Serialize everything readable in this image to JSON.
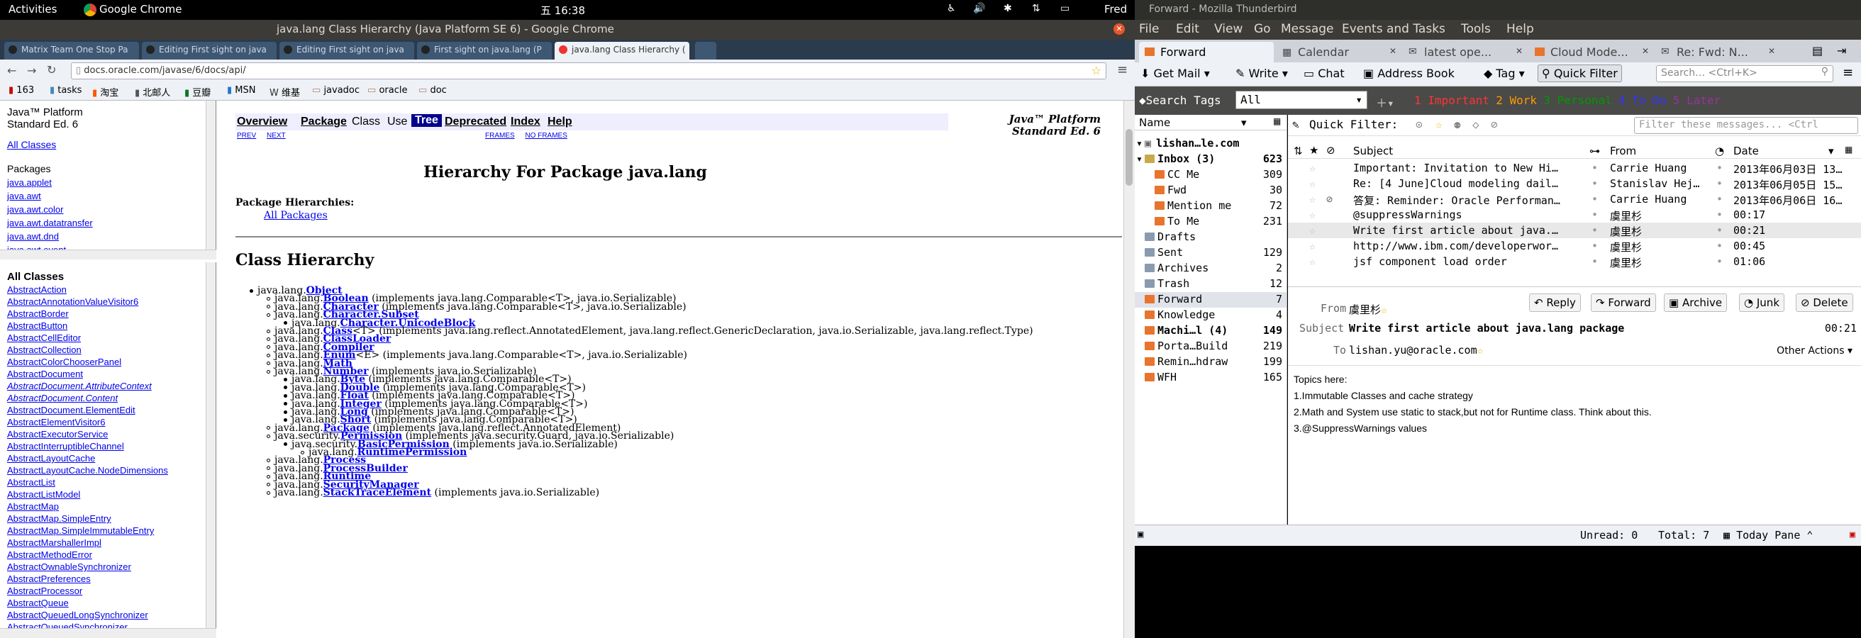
{
  "topbar": {
    "activities": "Activities",
    "app": "Google Chrome",
    "time": "五 16:38",
    "user": "Fred"
  },
  "chrome": {
    "title": "java.lang Class Hierarchy (Java Platform SE 6) - Google Chrome",
    "tabs": [
      "Matrix Team One Stop Pa",
      "Editing First sight on java",
      "Editing First sight on java",
      "First sight on java.lang (P",
      "java.lang Class Hierarchy ("
    ],
    "url": "docs.oracle.com/javase/6/docs/api/",
    "bookmarks": [
      "163",
      "tasks",
      "淘宝",
      "北邮人",
      "豆瓣",
      "MSN",
      "维基",
      "javadoc",
      "oracle",
      "doc"
    ]
  },
  "pkg_frame": {
    "title1": "Java™ Platform",
    "title2": "Standard Ed. 6",
    "all_classes": "All Classes",
    "packages_label": "Packages",
    "packages": [
      "java.applet",
      "java.awt",
      "java.awt.color",
      "java.awt.datatransfer",
      "java.awt.dnd",
      "java.awt.event"
    ]
  },
  "class_frame": {
    "heading": "All Classes",
    "classes": [
      "AbstractAction",
      "AbstractAnnotationValueVisitor6",
      "AbstractBorder",
      "AbstractButton",
      "AbstractCellEditor",
      "AbstractCollection",
      "AbstractColorChooserPanel",
      "AbstractDocument",
      "AbstractDocument.AttributeContext",
      "AbstractDocument.Content",
      "AbstractDocument.ElementEdit",
      "AbstractElementVisitor6",
      "AbstractExecutorService",
      "AbstractInterruptibleChannel",
      "AbstractLayoutCache",
      "AbstractLayoutCache.NodeDimensions",
      "AbstractList",
      "AbstractListModel",
      "AbstractMap",
      "AbstractMap.SimpleEntry",
      "AbstractMap.SimpleImmutableEntry",
      "AbstractMarshallerImpl",
      "AbstractMethodError",
      "AbstractOwnableSynchronizer",
      "AbstractPreferences",
      "AbstractProcessor",
      "AbstractQueue",
      "AbstractQueuedLongSynchronizer",
      "AbstractQueuedSynchronizer"
    ]
  },
  "main": {
    "nav": [
      "Overview",
      "Package",
      "Class",
      "Use",
      "Tree",
      "Deprecated",
      "Index",
      "Help"
    ],
    "prev": "PREV",
    "next": "NEXT",
    "frames": "FRAMES",
    "noframes": "NO FRAMES",
    "platform1": "Java™ Platform",
    "platform2": "Standard Ed. 6",
    "heading": "Hierarchy For Package java.lang",
    "pkg_hier_label": "Package Hierarchies:",
    "all_packages": "All Packages",
    "class_hierarchy": "Class Hierarchy",
    "tree": [
      {
        "level": 0,
        "prefix": "java.lang.",
        "name": "Object",
        "suffix": ""
      },
      {
        "level": 1,
        "prefix": "java.lang.",
        "name": "Boolean",
        "suffix": " (implements java.lang.Comparable<T>, java.io.Serializable)"
      },
      {
        "level": 1,
        "prefix": "java.lang.",
        "name": "Character",
        "suffix": " (implements java.lang.Comparable<T>, java.io.Serializable)"
      },
      {
        "level": 1,
        "prefix": "java.lang.",
        "name": "Character.Subset",
        "suffix": ""
      },
      {
        "level": 2,
        "prefix": "java.lang.",
        "name": "Character.UnicodeBlock",
        "suffix": ""
      },
      {
        "level": 1,
        "prefix": "java.lang.",
        "name": "Class",
        "suffix": "<T> (implements java.lang.reflect.AnnotatedElement, java.lang.reflect.GenericDeclaration, java.io.Serializable, java.lang.reflect.Type)"
      },
      {
        "level": 1,
        "prefix": "java.lang.",
        "name": "ClassLoader",
        "suffix": ""
      },
      {
        "level": 1,
        "prefix": "java.lang.",
        "name": "Compiler",
        "suffix": ""
      },
      {
        "level": 1,
        "prefix": "java.lang.",
        "name": "Enum",
        "suffix": "<E> (implements java.lang.Comparable<T>, java.io.Serializable)"
      },
      {
        "level": 1,
        "prefix": "java.lang.",
        "name": "Math",
        "suffix": ""
      },
      {
        "level": 1,
        "prefix": "java.lang.",
        "name": "Number",
        "suffix": " (implements java.io.Serializable)"
      },
      {
        "level": 2,
        "prefix": "java.lang.",
        "name": "Byte",
        "suffix": " (implements java.lang.Comparable<T>)"
      },
      {
        "level": 2,
        "prefix": "java.lang.",
        "name": "Double",
        "suffix": " (implements java.lang.Comparable<T>)"
      },
      {
        "level": 2,
        "prefix": "java.lang.",
        "name": "Float",
        "suffix": " (implements java.lang.Comparable<T>)"
      },
      {
        "level": 2,
        "prefix": "java.lang.",
        "name": "Integer",
        "suffix": " (implements java.lang.Comparable<T>)"
      },
      {
        "level": 2,
        "prefix": "java.lang.",
        "name": "Long",
        "suffix": " (implements java.lang.Comparable<T>)"
      },
      {
        "level": 2,
        "prefix": "java.lang.",
        "name": "Short",
        "suffix": " (implements java.lang.Comparable<T>)"
      },
      {
        "level": 1,
        "prefix": "java.lang.",
        "name": "Package",
        "suffix": " (implements java.lang.reflect.AnnotatedElement)"
      },
      {
        "level": 1,
        "prefix": "java.security.",
        "name": "Permission",
        "suffix": " (implements java.security.Guard, java.io.Serializable)"
      },
      {
        "level": 2,
        "prefix": "java.security.",
        "name": "BasicPermission",
        "suffix": " (implements java.io.Serializable)"
      },
      {
        "level": 3,
        "prefix": "java.lang.",
        "name": "RuntimePermission",
        "suffix": ""
      },
      {
        "level": 1,
        "prefix": "java.lang.",
        "name": "Process",
        "suffix": ""
      },
      {
        "level": 1,
        "prefix": "java.lang.",
        "name": "ProcessBuilder",
        "suffix": ""
      },
      {
        "level": 1,
        "prefix": "java.lang.",
        "name": "Runtime",
        "suffix": ""
      },
      {
        "level": 1,
        "prefix": "java.lang.",
        "name": "SecurityManager",
        "suffix": ""
      },
      {
        "level": 1,
        "prefix": "java.lang.",
        "name": "StackTraceElement",
        "suffix": " (implements java.io.Serializable)"
      }
    ]
  },
  "thunderbird": {
    "title": "Forward - Mozilla Thunderbird",
    "menu": [
      "File",
      "Edit",
      "View",
      "Go",
      "Message",
      "Events and Tasks",
      "Tools",
      "Help"
    ],
    "tabs": [
      "Forward",
      "Calendar",
      "latest ope...",
      "Cloud Mode...",
      "Re: Fwd: N..."
    ],
    "toolbar": [
      "Get Mail",
      "Write",
      "Chat",
      "Address Book",
      "Tag",
      "Quick Filter"
    ],
    "search_placeholder": "Search… <Ctrl+K>",
    "search_tags": "Search Tags",
    "tag_select": "All",
    "tags": [
      {
        "n": "1",
        "label": "Important",
        "color": "#ff3333"
      },
      {
        "n": "2",
        "label": "Work",
        "color": "#ff9900"
      },
      {
        "n": "3",
        "label": "Personal",
        "color": "#009900"
      },
      {
        "n": "4",
        "label": "To Do",
        "color": "#3333ff"
      },
      {
        "n": "5",
        "label": "Later",
        "color": "#993399"
      }
    ],
    "folder_col": "Name",
    "account": "lishan…le.com",
    "folders": [
      {
        "name": "Inbox (3)",
        "count": "623",
        "indent": 1,
        "bold": true
      },
      {
        "name": "CC Me",
        "count": "309",
        "indent": 2
      },
      {
        "name": "Fwd",
        "count": "30",
        "indent": 2
      },
      {
        "name": "Mention me",
        "count": "72",
        "indent": 2
      },
      {
        "name": "To Me",
        "count": "231",
        "indent": 2
      },
      {
        "name": "Drafts",
        "count": "",
        "indent": 1
      },
      {
        "name": "Sent",
        "count": "129",
        "indent": 1
      },
      {
        "name": "Archives",
        "count": "2",
        "indent": 1
      },
      {
        "name": "Trash",
        "count": "12",
        "indent": 1
      },
      {
        "name": "Forward",
        "count": "7",
        "indent": 1
      },
      {
        "name": "Knowledge",
        "count": "4",
        "indent": 1
      },
      {
        "name": "Machi…l (4)",
        "count": "149",
        "indent": 1,
        "bold": true
      },
      {
        "name": "Porta…Build",
        "count": "219",
        "indent": 1
      },
      {
        "name": "Remin…hdraw",
        "count": "199",
        "indent": 1
      },
      {
        "name": "WFH",
        "count": "165",
        "indent": 1
      }
    ],
    "quick_filter": "Quick Filter:",
    "filter_placeholder": "Filter these messages... <Ctrl",
    "columns": [
      "Subject",
      "From",
      "Date"
    ],
    "messages": [
      {
        "subject": "Important: Invitation to New Hi…",
        "from": "Carrie Huang",
        "date": "2013年06月03日 13…"
      },
      {
        "subject": "Re: [4 June]Cloud modeling dail…",
        "from": "Stanislav Hej…",
        "date": "2013年06月05日 15…"
      },
      {
        "subject": "答复: Reminder: Oracle Performan…",
        "from": "Carrie Huang",
        "date": "2013年06月06日 16…"
      },
      {
        "subject": "@suppressWarnings",
        "from": "虞里杉",
        "date": "00:17"
      },
      {
        "subject": "Write first article about java.…",
        "from": "虞里杉",
        "date": "00:21"
      },
      {
        "subject": "http://www.ibm.com/developerwor…",
        "from": "虞里杉",
        "date": "00:45"
      },
      {
        "subject": "jsf component load order",
        "from": "虞里杉",
        "date": "01:06"
      }
    ],
    "header": {
      "from_label": "From",
      "from": "虞里杉",
      "subject_label": "Subject",
      "subject": "Write first article about java.lang package",
      "time": "00:21",
      "to_label": "To",
      "to": "lishan.yu@oracle.com",
      "other_actions": "Other Actions"
    },
    "actions": [
      "Reply",
      "Forward",
      "Archive",
      "Junk",
      "Delete"
    ],
    "body": [
      "Topics here:",
      "1.Immutable Classes and cache strategy",
      "2.Math and System use static to stack,but not for Runtime class. Think about this.",
      "3.@SuppressWarnings values"
    ],
    "status": {
      "unread": "Unread: 0",
      "total": "Total: 7",
      "today": "Today Pane"
    }
  }
}
